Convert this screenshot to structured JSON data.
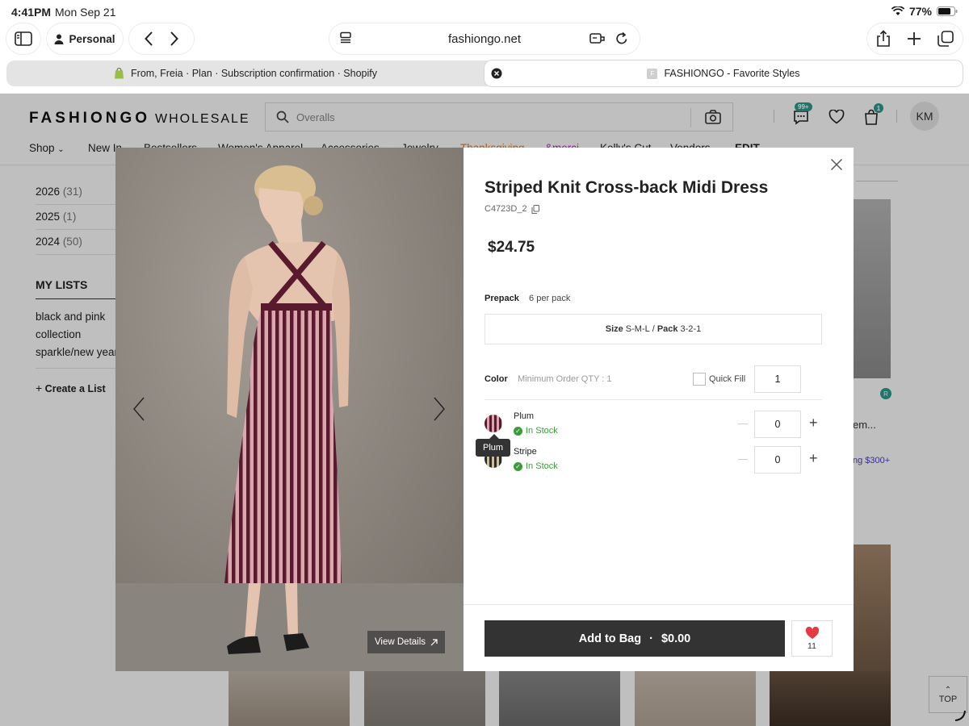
{
  "status_bar": {
    "time": "4:41PM",
    "date": "Mon Sep 21",
    "battery": "77%"
  },
  "browser": {
    "profile": "Personal",
    "url": "fashiongo.net",
    "tabs": [
      {
        "label": "From, Freia · Plan · Subscription confirmation · Shopify"
      },
      {
        "label": "FASHIONGO - Favorite Styles"
      }
    ]
  },
  "site": {
    "brand": "FASHIONGO",
    "brand_suffix": "WHOLESALE",
    "search_placeholder": "Overalls",
    "messages_badge": "99+",
    "cart_badge": "1",
    "avatar": "KM",
    "nav": [
      "Shop",
      "New In",
      "Bestsellers",
      "Women's Apparel",
      "Accessories",
      "Jewelry",
      "Thanksgiving",
      "&merci",
      "Kelly's Cut",
      "Vendors",
      "EDIT"
    ],
    "years": [
      {
        "year": "2026",
        "count": "(31)"
      },
      {
        "year": "2025",
        "count": "(1)"
      },
      {
        "year": "2024",
        "count": "(50)"
      }
    ],
    "my_lists_title": "MY LISTS",
    "lists": [
      "black and pink",
      "collection",
      "sparkle/new year"
    ],
    "create_list": "Create a List",
    "bg_text_1": "em...",
    "bg_text_2": "ng $300+",
    "top_label": "TOP"
  },
  "modal": {
    "title": "Striped Knit Cross-back Midi Dress",
    "sku": "C4723D_2",
    "price": "$24.75",
    "prepack_label": "Prepack",
    "prepack_value": "6 per pack",
    "size_label": "Size",
    "size_value": "S-M-L",
    "pack_label": "Pack",
    "pack_value": "3-2-1",
    "color_label": "Color",
    "min_order": "Minimum Order QTY : 1",
    "quick_fill_label": "Quick Fill",
    "quick_fill_qty": "1",
    "variants": [
      {
        "name": "Plum",
        "stock": "In Stock",
        "qty": "0"
      },
      {
        "name": "Stripe",
        "stock": "In Stock",
        "qty": "0"
      }
    ],
    "tooltip": "Plum",
    "view_details": "View Details",
    "add_to_bag": "Add to Bag",
    "bag_total": "$0.00",
    "fav_count": "11",
    "colors": {
      "plum": "#5a1a2e",
      "pink": "#d9a7ad",
      "stock_green": "#3c9b3c",
      "heart": "#e63946"
    }
  }
}
